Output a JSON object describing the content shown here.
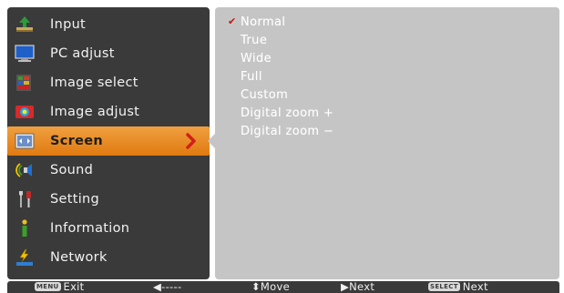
{
  "menu": {
    "items": [
      {
        "label": "Input",
        "icon": "input-icon"
      },
      {
        "label": "PC adjust",
        "icon": "pc-adjust-icon"
      },
      {
        "label": "Image select",
        "icon": "image-select-icon"
      },
      {
        "label": "Image adjust",
        "icon": "image-adjust-icon"
      },
      {
        "label": "Screen",
        "icon": "screen-icon",
        "selected": true
      },
      {
        "label": "Sound",
        "icon": "sound-icon"
      },
      {
        "label": "Setting",
        "icon": "setting-icon"
      },
      {
        "label": "Information",
        "icon": "information-icon"
      },
      {
        "label": "Network",
        "icon": "network-icon"
      }
    ]
  },
  "options": {
    "check_mark": "✔",
    "items": [
      {
        "label": "Normal",
        "checked": true
      },
      {
        "label": "True"
      },
      {
        "label": "Wide"
      },
      {
        "label": "Full"
      },
      {
        "label": "Custom"
      },
      {
        "label": "Digital zoom +"
      },
      {
        "label": "Digital zoom −"
      }
    ]
  },
  "footer": {
    "menu_key": "MENU",
    "exit_label": "Exit",
    "back_label": "◀-----",
    "move_label": "⬍Move",
    "next_label": "▶Next",
    "select_key": "SELECT",
    "select_next_label": "Next"
  },
  "colors": {
    "menu_bg": "#3a3a3a",
    "panel_bg": "#c5c5c5",
    "highlight": "#e8861f",
    "check": "#c01818"
  }
}
